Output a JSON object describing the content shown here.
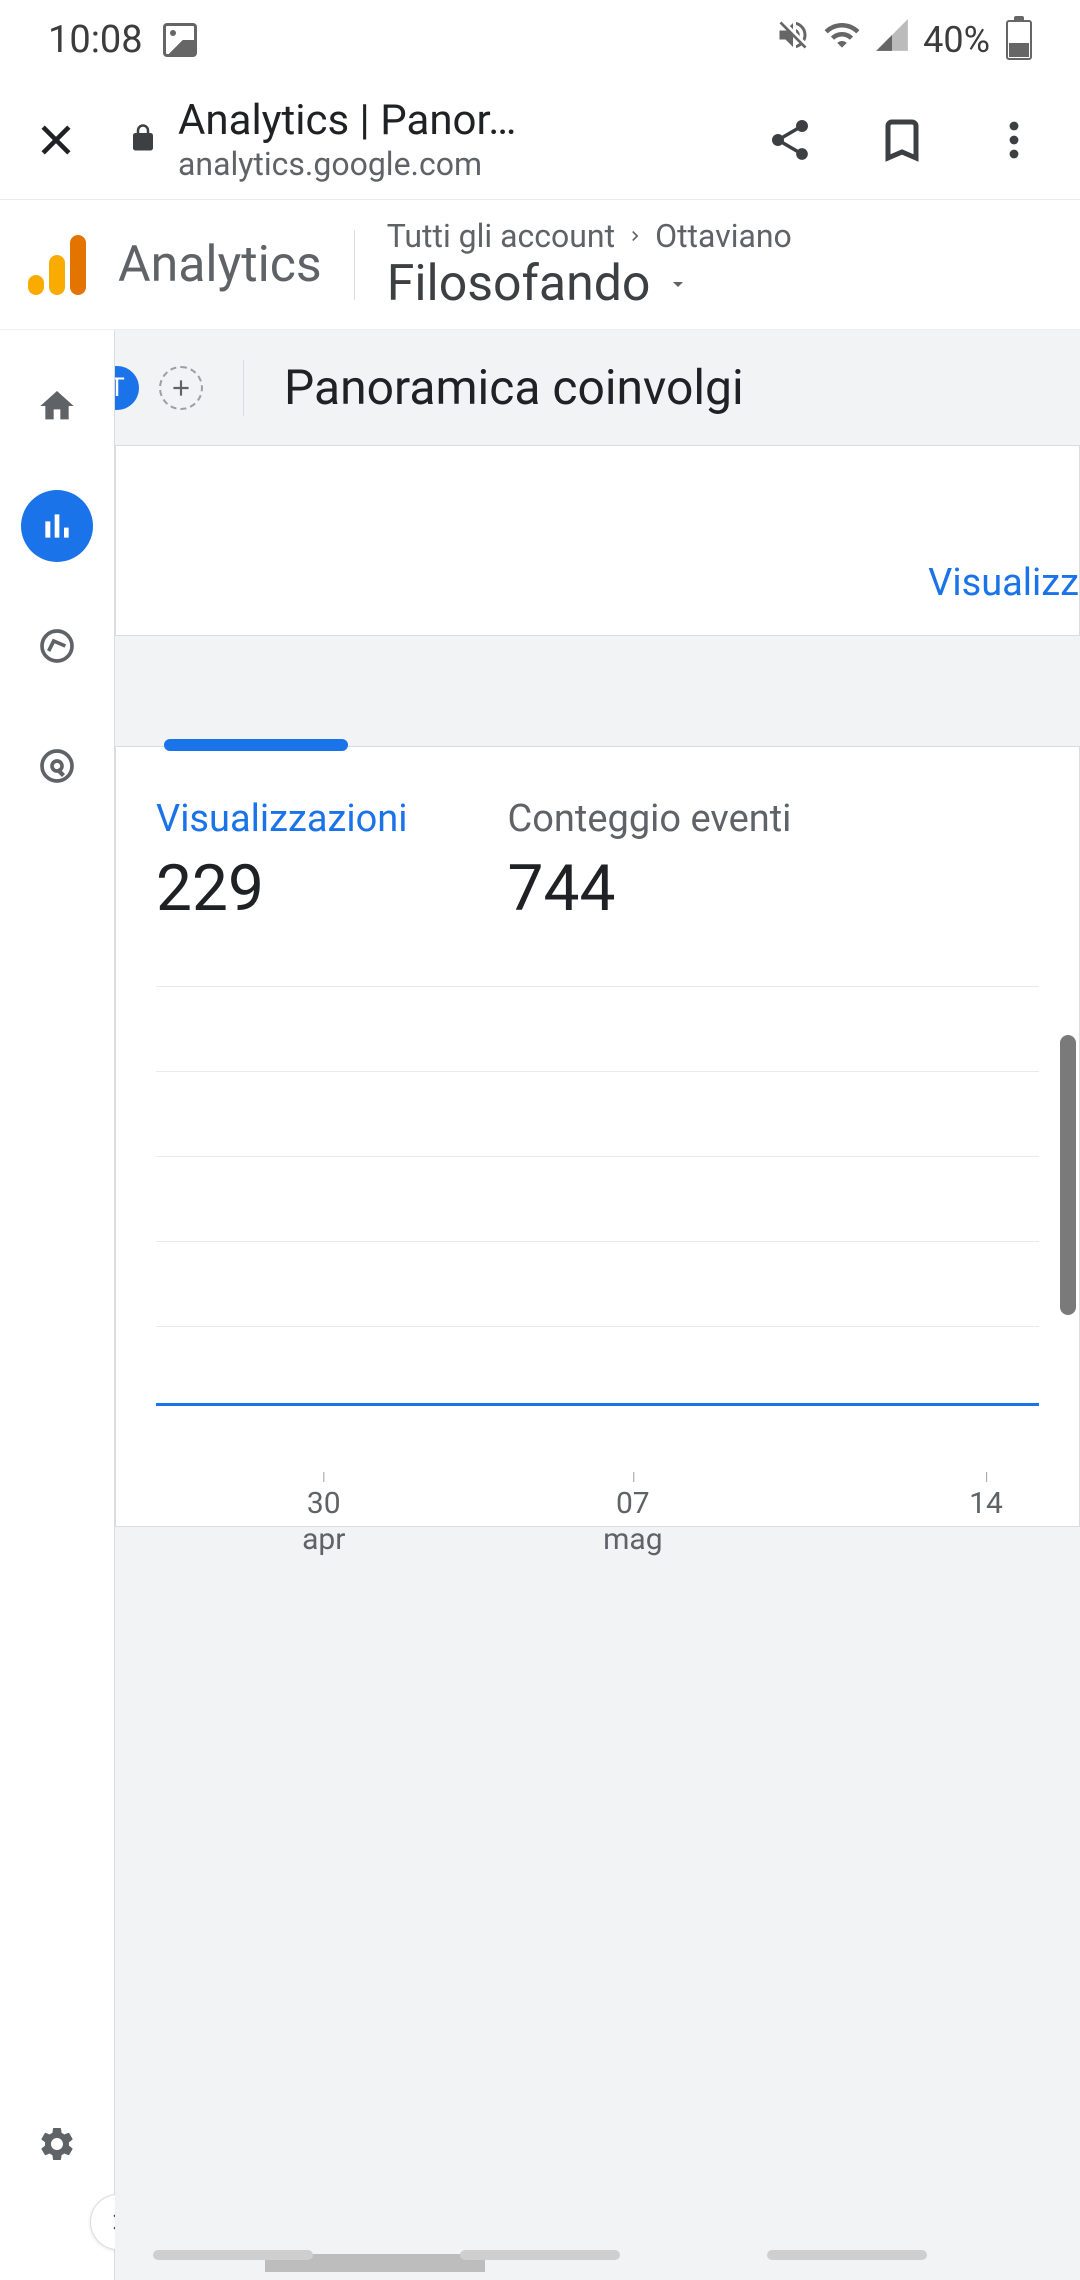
{
  "status": {
    "time": "10:08",
    "battery": "40%"
  },
  "browser": {
    "title": "Analytics | Panor…",
    "url": "analytics.google.com"
  },
  "ga": {
    "brand": "Analytics",
    "breadcrumb_accounts": "Tutti gli account",
    "breadcrumb_user": "Ottaviano",
    "property": "Filosofando"
  },
  "tabs": {
    "chip": "T",
    "title": "Panoramica coinvolgi"
  },
  "card1": {
    "link": "Visualizz"
  },
  "metrics": [
    {
      "label": "Visualizzazioni",
      "value": "229"
    },
    {
      "label": "Conteggio eventi",
      "value": "744"
    }
  ],
  "chart_data": {
    "type": "line",
    "x_ticks": [
      {
        "day": "30",
        "month": "apr"
      },
      {
        "day": "07",
        "month": "mag"
      },
      {
        "day": "14",
        "month": ""
      }
    ],
    "series": [
      {
        "name": "Visualizzazioni",
        "values": []
      }
    ],
    "ylim": [
      0,
      null
    ]
  }
}
